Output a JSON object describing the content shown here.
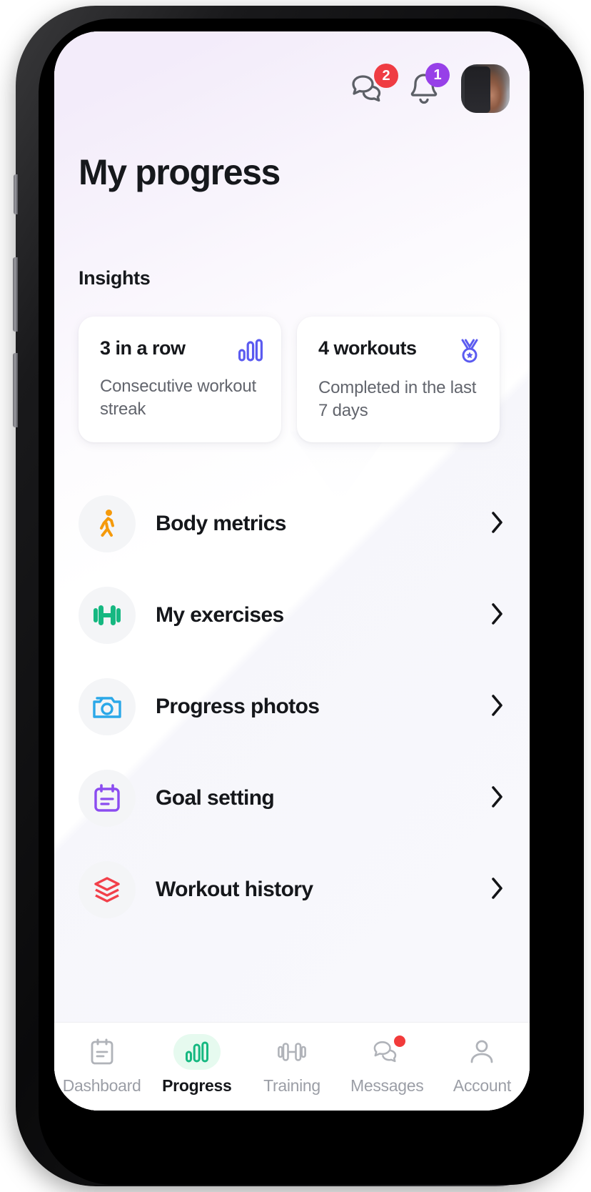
{
  "header": {
    "messages_icon": "chat-bubbles-icon",
    "messages_badge": "2",
    "notifications_icon": "bell-icon",
    "notifications_badge": "1",
    "avatar_label": "user-avatar"
  },
  "page": {
    "title": "My progress",
    "insights_heading": "Insights"
  },
  "insights": [
    {
      "title": "3 in a row",
      "subtitle": "Consecutive workout streak",
      "icon": "bar-chart-icon",
      "icon_color": "#5b5bf0"
    },
    {
      "title": "4 workouts",
      "subtitle": "Completed in the last 7 days",
      "icon": "medal-icon",
      "icon_color": "#5b5bf0"
    }
  ],
  "menu": [
    {
      "label": "Body metrics",
      "icon": "walking-person-icon",
      "icon_color": "#f59a0b"
    },
    {
      "label": "My exercises",
      "icon": "dumbbell-icon",
      "icon_color": "#16b881"
    },
    {
      "label": "Progress photos",
      "icon": "camera-icon",
      "icon_color": "#2ba8e8"
    },
    {
      "label": "Goal setting",
      "icon": "calendar-note-icon",
      "icon_color": "#8b4cf0"
    },
    {
      "label": "Workout history",
      "icon": "layers-icon",
      "icon_color": "#f2404a"
    }
  ],
  "bottom_nav": {
    "items": [
      {
        "label": "Dashboard",
        "icon": "clipboard-icon",
        "active": false,
        "dot": false
      },
      {
        "label": "Progress",
        "icon": "bar-chart-icon",
        "active": true,
        "dot": false
      },
      {
        "label": "Training",
        "icon": "dumbbell-icon",
        "active": false,
        "dot": false
      },
      {
        "label": "Messages",
        "icon": "chat-bubbles-icon",
        "active": false,
        "dot": true
      },
      {
        "label": "Account",
        "icon": "person-icon",
        "active": false,
        "dot": false
      }
    ]
  },
  "colors": {
    "accent_green": "#16b881",
    "accent_indigo": "#5b5bf0",
    "badge_red": "#ef3c43",
    "badge_purple": "#9740e8",
    "text_primary": "#15171b",
    "text_muted": "#9b9ea6"
  }
}
